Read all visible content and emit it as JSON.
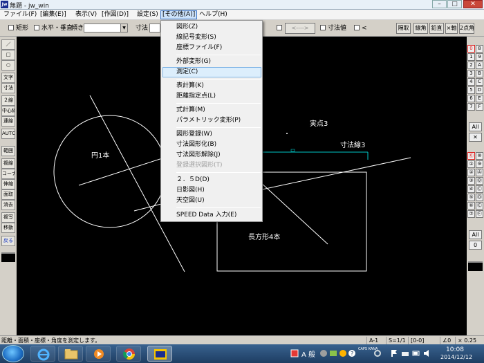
{
  "window": {
    "logo": "Jw",
    "title": "無題 - jw_win"
  },
  "menubar": {
    "items": [
      "ファイル(F)",
      "[編集(E)]",
      "表示(V)",
      "[作図(D)]",
      "設定(S)",
      "[その他(A)]",
      "ヘルプ(H)"
    ]
  },
  "toolbar": {
    "rect_label": "矩形",
    "hv_label": "水平・垂直",
    "slope_label": "傾き",
    "dim_label": "寸法",
    "arrow_label": "<---->",
    "dimval_label": "寸法値",
    "lt_label": "<",
    "right_buttons": [
      "隔取",
      "線角",
      "鉛直",
      "×軸",
      "2点角"
    ]
  },
  "left_tools": [
    "／",
    "□",
    "○",
    "文字",
    "寸法",
    "２線",
    "中心線",
    "連線",
    "AUTO",
    "範囲",
    "複線",
    "コーナー",
    "伸縮",
    "面取",
    "消去",
    "複写",
    "移動",
    "戻る"
  ],
  "right_layers": {
    "group1": [
      "0",
      "8",
      "1",
      "9",
      "2",
      "A",
      "3",
      "B",
      "4",
      "C",
      "5",
      "D",
      "6",
      "E",
      "7",
      "F"
    ],
    "group2": [
      "⓪",
      "⑧",
      "①",
      "⑨",
      "②",
      "Ⓐ",
      "③",
      "Ⓑ",
      "④",
      "Ⓒ",
      "⑤",
      "Ⓓ",
      "⑥",
      "Ⓔ",
      "⑦",
      "Ⓕ"
    ],
    "all": "All",
    "x_label": "✕",
    "zero": "0"
  },
  "canvas": {
    "labels": {
      "circle": "円1本",
      "point": "実点3",
      "dimension": "寸法線3",
      "rectangle": "長方形4本"
    },
    "colors": {
      "background": "#000000",
      "line": "#ffffff",
      "dimension": "#00c8c8"
    }
  },
  "dropdown": {
    "items": [
      "図形(Z)",
      "線記号変形(S)",
      "座標ファイル(F)",
      "外部変形(G)",
      "測定(C)",
      "表計算(K)",
      "距離指定点(L)",
      "式計算(M)",
      "パラメトリック変形(P)",
      "図形登録(W)",
      "寸法図形化(B)",
      "寸法図形解除(J)",
      "登録選択図形(T)",
      "２．５D(D)",
      "日影図(H)",
      "天空図(U)",
      "SPEED Data 入力(E)"
    ],
    "highlighted": "測定(C)",
    "disabled": "登録選択図形(T)"
  },
  "statusbar": {
    "message": "距離・面積・座標・角度を測定します。",
    "paper": "A-1",
    "scale": "S=1/1",
    "layer": "[0-0]",
    "angle": "∠0",
    "zoom": "× 0.25"
  },
  "taskbar": {
    "ime": "A 般",
    "time": "10:08",
    "date": "2014/12/12",
    "ime_small": "CAPS KANA"
  }
}
